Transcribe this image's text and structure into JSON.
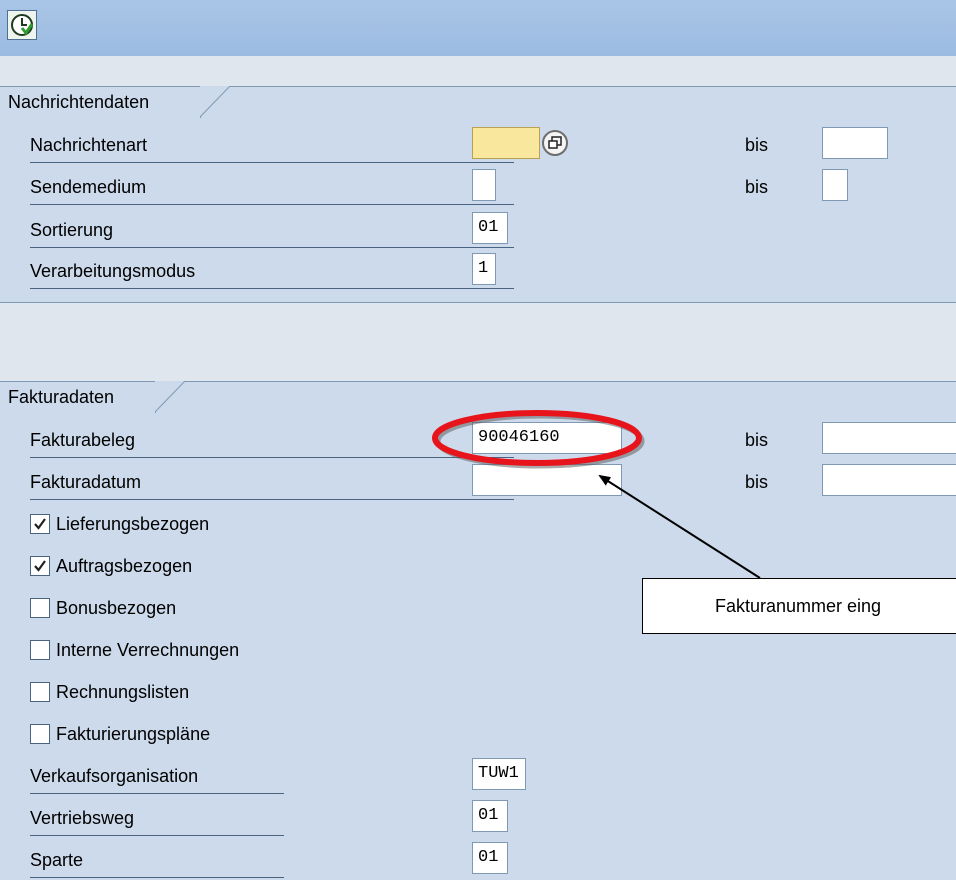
{
  "toolbar": {
    "execute_icon": "execute-clock-icon"
  },
  "nachrichtendaten": {
    "title": "Nachrichtendaten",
    "rows": [
      {
        "label": "Nachrichtenart",
        "value": "",
        "bis_label": "bis",
        "bis_value": ""
      },
      {
        "label": "Sendemedium",
        "value": "",
        "bis_label": "bis",
        "bis_value": ""
      },
      {
        "label": "Sortierung",
        "value": "01"
      },
      {
        "label": "Verarbeitungsmodus",
        "value": "1"
      }
    ]
  },
  "fakturadaten": {
    "title": "Fakturadaten",
    "fakturabeleg": {
      "label": "Fakturabeleg",
      "value": "90046160",
      "bis_label": "bis",
      "bis_value": ""
    },
    "fakturadatum": {
      "label": "Fakturadatum",
      "value": "",
      "bis_label": "bis",
      "bis_value": ""
    },
    "checkboxes": [
      {
        "label": "Lieferungsbezogen",
        "checked": true
      },
      {
        "label": "Auftragsbezogen",
        "checked": true
      },
      {
        "label": "Bonusbezogen",
        "checked": false
      },
      {
        "label": "Interne Verrechnungen",
        "checked": false
      },
      {
        "label": "Rechnungslisten",
        "checked": false
      },
      {
        "label": "Fakturierungspläne",
        "checked": false
      }
    ],
    "verkaufsorganisation": {
      "label": "Verkaufsorganisation",
      "value": "TUW1"
    },
    "vertriebsweg": {
      "label": "Vertriebsweg",
      "value": "01"
    },
    "sparte": {
      "label": "Sparte",
      "value": "01"
    }
  },
  "annotation": {
    "callout_text": "Fakturanummer eing",
    "highlight_color": "#e8141c"
  },
  "colors": {
    "toolbar": "#a9c5e6",
    "group_background": "#ccdaeb",
    "required_field": "#fae79e"
  }
}
